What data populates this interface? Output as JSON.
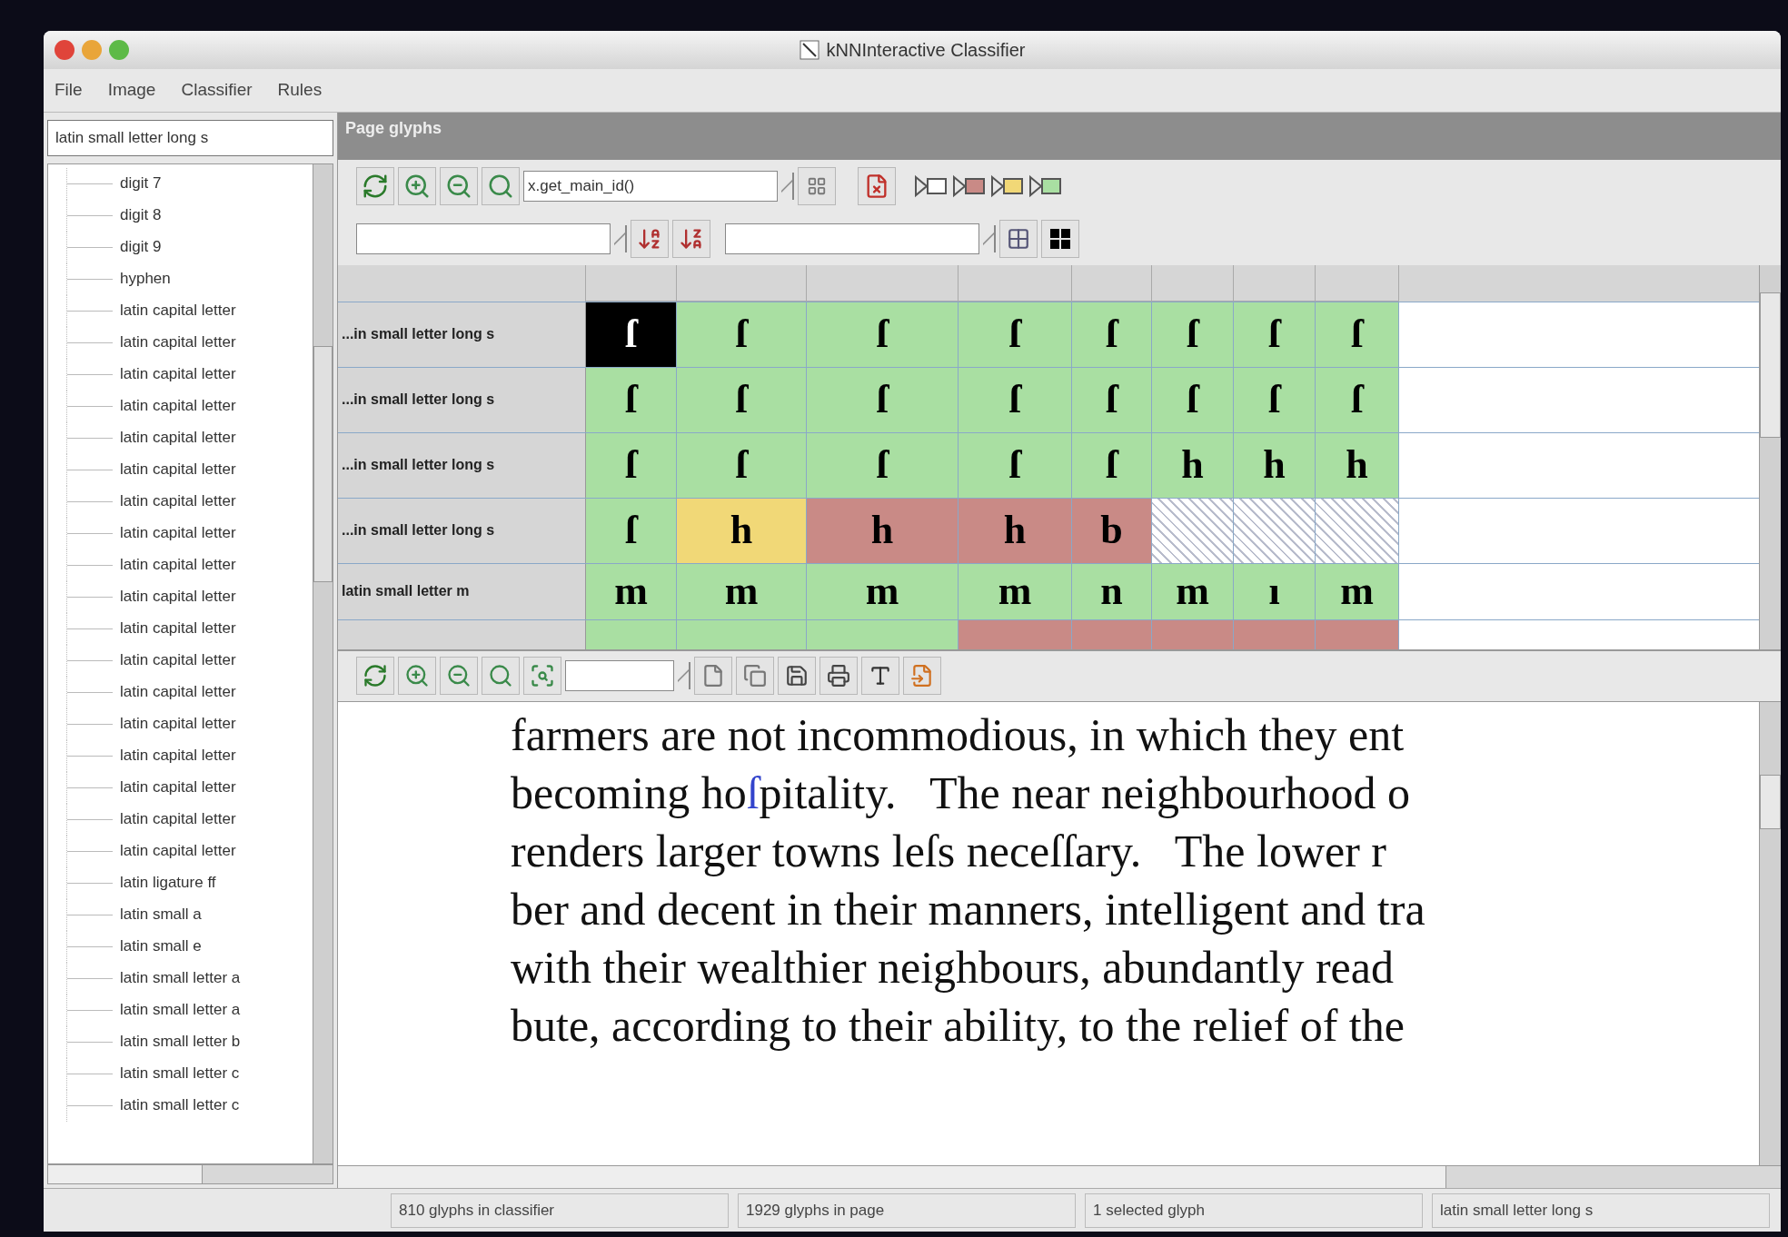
{
  "window": {
    "title": "kNNInteractive Classifier"
  },
  "menu": [
    "File",
    "Image",
    "Classifier",
    "Rules"
  ],
  "class_field": {
    "value": "latin small letter long s"
  },
  "tree": {
    "items": [
      "digit 7",
      "digit 8",
      "digit 9",
      "hyphen",
      "latin capital letter",
      "latin capital letter",
      "latin capital letter",
      "latin capital letter",
      "latin capital letter",
      "latin capital letter",
      "latin capital letter",
      "latin capital letter",
      "latin capital letter",
      "latin capital letter",
      "latin capital letter",
      "latin capital letter",
      "latin capital letter",
      "latin capital letter",
      "latin capital letter",
      "latin capital letter",
      "latin capital letter",
      "latin capital letter",
      "latin ligature ff",
      "latin small a",
      "latin small e",
      "latin small letter a",
      "latin small letter a",
      "latin small letter b",
      "latin small letter c",
      "latin small letter c"
    ]
  },
  "glyph_panel": {
    "title": "Page glyphs",
    "sort_field": {
      "value": "x.get_main_id()"
    },
    "rows": [
      {
        "label": "...in small letter long s",
        "cells": [
          {
            "glyph": "ſ",
            "kind": "selected"
          },
          {
            "glyph": "ſ",
            "kind": "classified"
          },
          {
            "glyph": "ſ",
            "kind": "classified"
          },
          {
            "glyph": "ſ",
            "kind": "classified"
          },
          {
            "glyph": "ſ",
            "kind": "classified"
          },
          {
            "glyph": "ſ",
            "kind": "classified"
          },
          {
            "glyph": "ſ",
            "kind": "classified"
          },
          {
            "glyph": "ſ",
            "kind": "classified"
          }
        ]
      },
      {
        "label": "...in small letter long s",
        "cells": [
          {
            "glyph": "ſ",
            "kind": "classified"
          },
          {
            "glyph": "ſ",
            "kind": "classified"
          },
          {
            "glyph": "ſ",
            "kind": "classified"
          },
          {
            "glyph": "ſ",
            "kind": "classified"
          },
          {
            "glyph": "ſ",
            "kind": "classified"
          },
          {
            "glyph": "ſ",
            "kind": "classified"
          },
          {
            "glyph": "ſ",
            "kind": "classified"
          },
          {
            "glyph": "ſ",
            "kind": "classified"
          }
        ]
      },
      {
        "label": "...in small letter long s",
        "cells": [
          {
            "glyph": "ſ",
            "kind": "classified"
          },
          {
            "glyph": "ſ",
            "kind": "classified"
          },
          {
            "glyph": "ſ",
            "kind": "classified"
          },
          {
            "glyph": "ſ",
            "kind": "classified"
          },
          {
            "glyph": "ſ",
            "kind": "classified"
          },
          {
            "glyph": "h",
            "kind": "classified"
          },
          {
            "glyph": "h",
            "kind": "classified"
          },
          {
            "glyph": "h",
            "kind": "classified"
          }
        ]
      },
      {
        "label": "...in small letter long s",
        "cells": [
          {
            "glyph": "ſ",
            "kind": "classified"
          },
          {
            "glyph": "h",
            "kind": "uncertain"
          },
          {
            "glyph": "h",
            "kind": "flagged"
          },
          {
            "glyph": "h",
            "kind": "flagged"
          },
          {
            "glyph": "b",
            "kind": "flagged"
          },
          {
            "kind": "empty"
          },
          {
            "kind": "empty"
          },
          {
            "kind": "empty"
          }
        ]
      },
      {
        "label": "latin small letter m",
        "cells": [
          {
            "glyph": "m",
            "kind": "classified"
          },
          {
            "glyph": "m",
            "kind": "classified"
          },
          {
            "glyph": "m",
            "kind": "classified"
          },
          {
            "glyph": "m",
            "kind": "classified"
          },
          {
            "glyph": "n",
            "kind": "classified"
          },
          {
            "glyph": "m",
            "kind": "classified"
          },
          {
            "glyph": "ı",
            "kind": "classified"
          },
          {
            "glyph": "m",
            "kind": "classified"
          }
        ]
      },
      {
        "cells": [
          {
            "kind": "classified"
          },
          {
            "kind": "classified"
          },
          {
            "kind": "classified"
          },
          {
            "kind": "flagged"
          },
          {
            "kind": "flagged"
          },
          {
            "kind": "flagged"
          },
          {
            "kind": "flagged"
          },
          {
            "kind": "flagged"
          }
        ]
      }
    ]
  },
  "page_view": {
    "lines": [
      [
        {
          "text": "farmers are not incommodious, in which they ent",
          "highlighted": false
        }
      ],
      [
        {
          "text": "becoming ho",
          "highlighted": false
        },
        {
          "text": "ſ",
          "highlighted": true
        },
        {
          "text": "pitality.   The near neighbourhood o",
          "highlighted": false
        }
      ],
      [
        {
          "text": "renders larger towns leſs neceſſary.   The lower r",
          "highlighted": false
        }
      ],
      [
        {
          "text": "ber and decent in their manners, intelligent and tra",
          "highlighted": false
        }
      ],
      [
        {
          "text": "with their wealthier neighbours, abundantly read",
          "highlighted": false
        }
      ],
      [
        {
          "text": "bute, according to their ability, to the relief of the",
          "highlighted": false
        }
      ]
    ]
  },
  "status_bar": [
    "810 glyphs in classifier",
    "1929 glyphs in page",
    "1 selected glyph",
    "latin small letter long s"
  ]
}
